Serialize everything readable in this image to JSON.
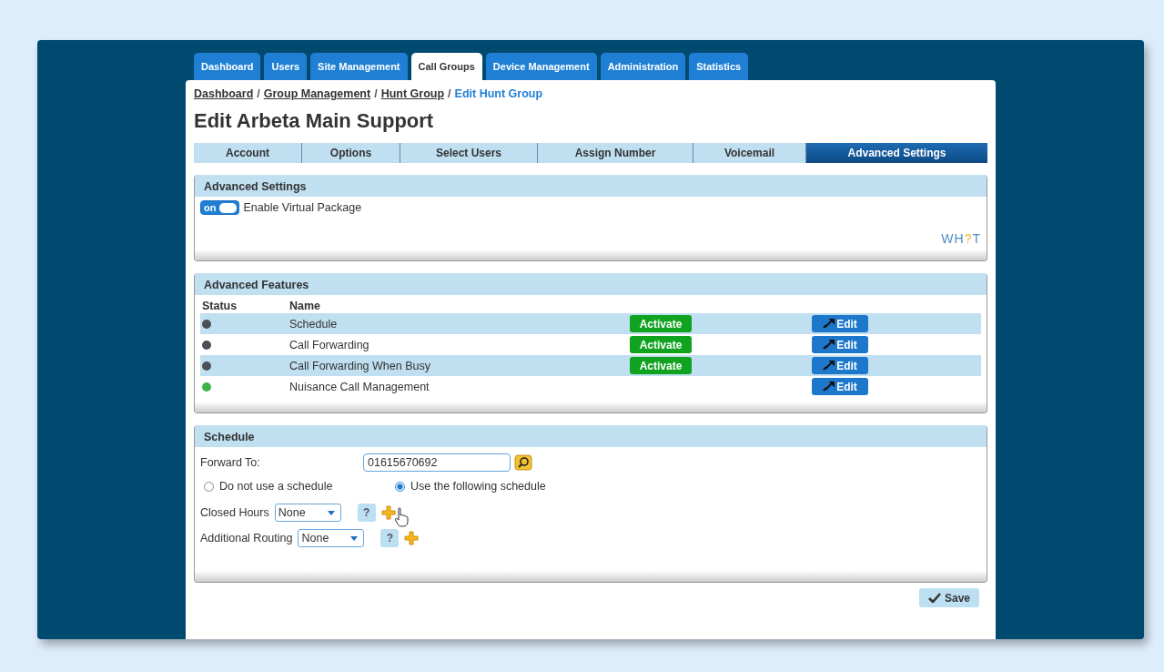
{
  "nav_tabs": [
    {
      "label": "Dashboard",
      "selected": false
    },
    {
      "label": "Users",
      "selected": false
    },
    {
      "label": "Site Management",
      "selected": false
    },
    {
      "label": "Call Groups",
      "selected": true
    },
    {
      "label": "Device Management",
      "selected": false
    },
    {
      "label": "Administration",
      "selected": false
    },
    {
      "label": "Statistics",
      "selected": false
    }
  ],
  "breadcrumb": [
    {
      "label": "Dashboard",
      "kind": "link"
    },
    {
      "label": "Group Management",
      "kind": "link"
    },
    {
      "label": "Hunt Group",
      "kind": "link"
    },
    {
      "label": "Edit Hunt Group",
      "kind": "current"
    }
  ],
  "breadcrumb_separator": "/",
  "title": "Edit Arbeta Main Support",
  "sub_tabs": [
    {
      "label": "Account",
      "selected": false
    },
    {
      "label": "Options",
      "selected": false
    },
    {
      "label": "Select Users",
      "selected": false
    },
    {
      "label": "Assign Number",
      "selected": false
    },
    {
      "label": "Voicemail",
      "selected": false
    },
    {
      "label": "Advanced Settings",
      "selected": true
    }
  ],
  "advanced_settings": {
    "title": "Advanced Settings",
    "toggle": {
      "label": "on",
      "on": true
    },
    "toggle_text": "Enable Virtual Package",
    "logo_parts": [
      {
        "text": "WH",
        "kind": "plain"
      },
      {
        "text": "?",
        "kind": "accent"
      },
      {
        "text": "T",
        "kind": "plain"
      }
    ]
  },
  "advanced_features": {
    "title": "Advanced Features",
    "columns": [
      "Status",
      "Name"
    ],
    "rows": [
      {
        "name": "Schedule",
        "color": "#4b4f56",
        "activate": "Activate",
        "edit": "Edit"
      },
      {
        "name": "Call Forwarding",
        "color": "#4b4f56",
        "activate": "Activate",
        "edit": "Edit"
      },
      {
        "name": "Call Forwarding When Busy",
        "color": "#4b4f56",
        "activate": "Activate",
        "edit": "Edit"
      },
      {
        "name": "Nuisance Call Management",
        "color": "#3fb34a",
        "edit": "Edit"
      }
    ]
  },
  "schedule": {
    "title": "Schedule",
    "forward_label": "Forward To:",
    "forward_value": "01615670692",
    "radios": [
      {
        "label": "Do not use a schedule",
        "selected": false
      },
      {
        "label": "Use the following schedule",
        "selected": true
      }
    ],
    "rows": [
      {
        "label": "Closed Hours",
        "value": "None",
        "help": "?"
      },
      {
        "label": "Additional Routing",
        "value": "None",
        "help": "?"
      }
    ]
  },
  "save_button": "Save"
}
